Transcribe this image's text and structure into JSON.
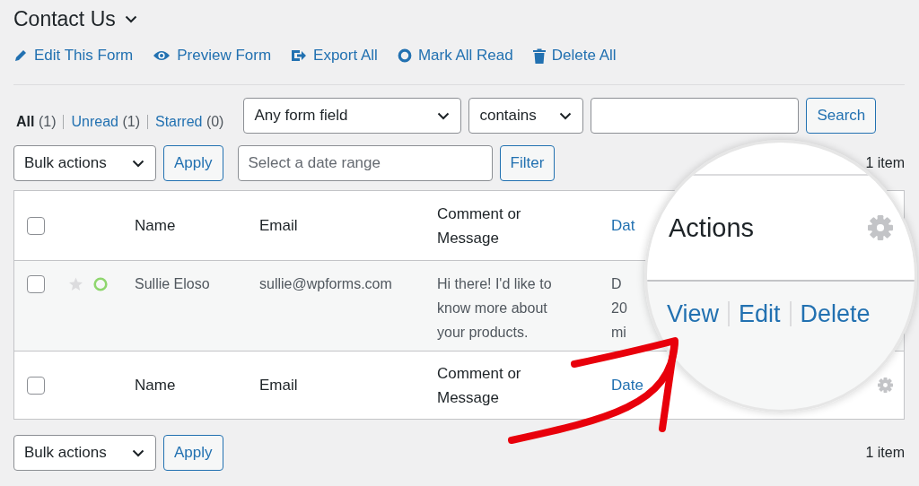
{
  "title": "Contact Us",
  "links": [
    {
      "label": "Edit This Form",
      "kind": "pencil"
    },
    {
      "label": "Preview Form",
      "kind": "eye"
    },
    {
      "label": "Export All",
      "kind": "export"
    },
    {
      "label": "Mark All Read",
      "kind": "ring"
    },
    {
      "label": "Delete All",
      "kind": "trash"
    }
  ],
  "views": [
    {
      "label": "All",
      "count": "(1)",
      "selected": true
    },
    {
      "label": "Unread",
      "count": "(1)",
      "selected": false
    },
    {
      "label": "Starred",
      "count": "(0)",
      "selected": false
    }
  ],
  "field_select": "Any form field",
  "operator_select": "contains",
  "search_button": "Search",
  "bulk_actions_top": "Bulk actions",
  "apply_top": "Apply",
  "date_range": {
    "placeholder": "Select a date range"
  },
  "filter_button": "Filter",
  "item_count_top": "1 item",
  "table": {
    "header": {
      "checked": false,
      "name": "Name",
      "email": "Email",
      "comment": "Comment or Message",
      "date": "Dat"
    },
    "rows": [
      {
        "checked": false,
        "starred": false,
        "unread": true,
        "name": "Sullie Eloso",
        "email": "sullie@wpforms.com",
        "comment": "Hi there! I'd like to know more about your products.",
        "date_lines": [
          "D",
          "20",
          "mi"
        ]
      }
    ],
    "footer": {
      "checked": false,
      "name": "Name",
      "email": "Email",
      "comment": "Comment or Message",
      "date": "Date"
    }
  },
  "bulk_actions_bottom": "Bulk actions",
  "apply_bottom": "Apply",
  "item_count_bottom": "1 item",
  "magnifier": {
    "heading": "Actions",
    "actions": [
      "View",
      "Edit",
      "Delete"
    ]
  }
}
